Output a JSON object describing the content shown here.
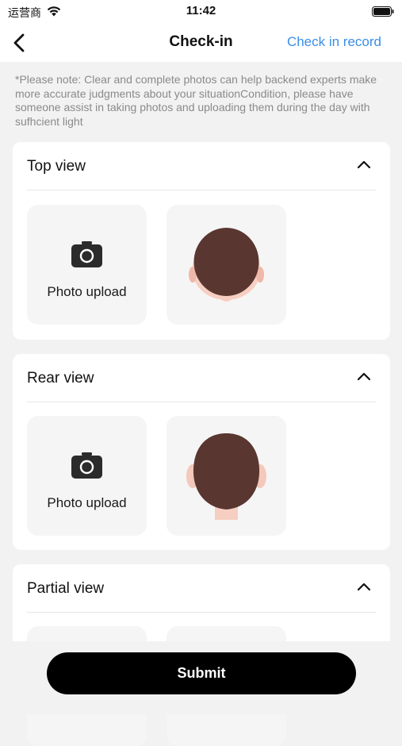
{
  "status_bar": {
    "carrier": "运营商",
    "time": "11:42"
  },
  "nav": {
    "title": "Check-in",
    "record_link": "Check in record"
  },
  "note": "*Please note: Clear and complete photos can help backend experts make more accurate judgments about your situationCondition, please have someone assist in taking photos and uploading them during the day with sufhcient light",
  "sections": [
    {
      "title": "Top view",
      "upload_label": "Photo upload",
      "expanded": true
    },
    {
      "title": "Rear view",
      "upload_label": "Photo upload",
      "expanded": true
    },
    {
      "title": "Partial view",
      "expanded": true
    }
  ],
  "submit_label": "Submit",
  "colors": {
    "accent": "#3a8ee6",
    "hair": "#5a3630",
    "skin": "#f6cfc2",
    "button": "#000000"
  }
}
